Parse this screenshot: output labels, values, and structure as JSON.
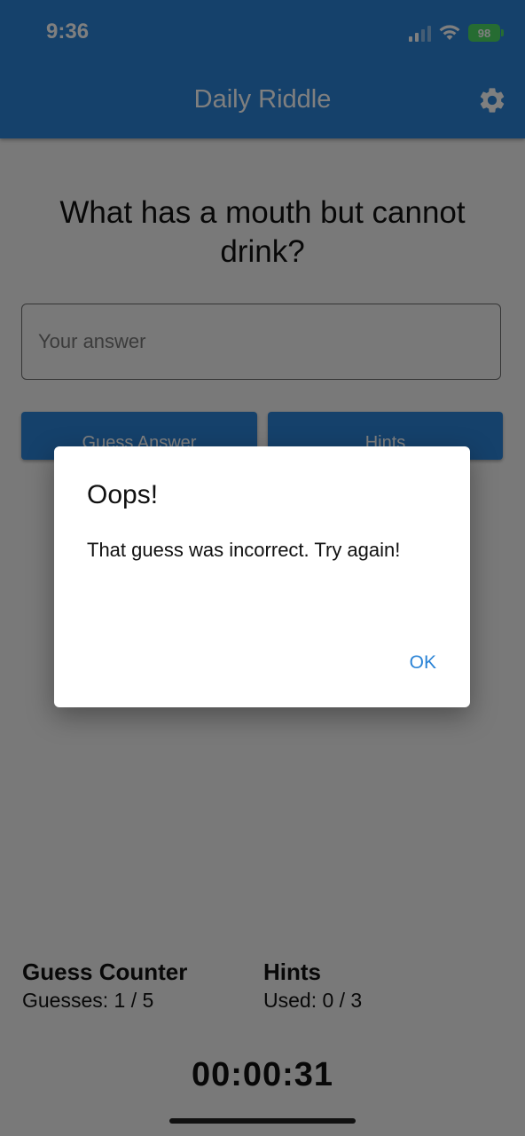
{
  "status_bar": {
    "time": "9:36",
    "battery": "98"
  },
  "app_bar": {
    "title": "Daily Riddle",
    "settings_icon": "gear-icon"
  },
  "riddle": {
    "question": "What has a mouth but cannot drink?"
  },
  "answer_input": {
    "placeholder": "Your answer",
    "value": ""
  },
  "buttons": {
    "guess_label": "Guess Answer",
    "hints_label": "Hints"
  },
  "guess_counter": {
    "title": "Guess Counter",
    "text": "Guesses: 1 / 5"
  },
  "hints_counter": {
    "title": "Hints",
    "text": "Used: 0 / 3"
  },
  "timer": {
    "value": "00:00:31"
  },
  "dialog": {
    "title": "Oops!",
    "message": "That guess was incorrect. Try again!",
    "ok_label": "OK"
  },
  "colors": {
    "primary": "#2a83d6",
    "battery": "#4cd964"
  }
}
